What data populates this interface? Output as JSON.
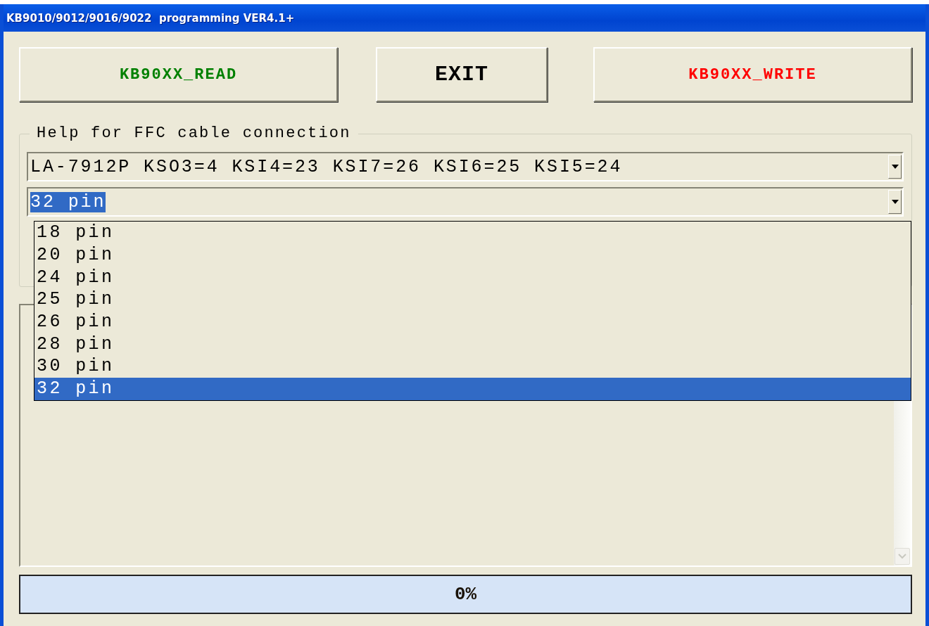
{
  "window": {
    "title": "KB9010/9012/9016/9022  programming VER4.1+"
  },
  "buttons": [
    {
      "label": "KB90XX_READ",
      "color": "#008000"
    },
    {
      "label": "EXIT",
      "color": "#000000"
    },
    {
      "label": "KB90XX_WRITE",
      "color": "#ff0000"
    }
  ],
  "help_group": {
    "legend": "Help for FFC cable connection",
    "cable_combo": {
      "value": "LA-7912P KSO3=4 KSI4=23 KSI7=26 KSI6=25 KSI5=24"
    },
    "pin_combo": {
      "value": "32 pin",
      "options": [
        {
          "label": "18 pin",
          "selected": false
        },
        {
          "label": "20 pin",
          "selected": false
        },
        {
          "label": "24 pin",
          "selected": false
        },
        {
          "label": "25 pin",
          "selected": false
        },
        {
          "label": "26 pin",
          "selected": false
        },
        {
          "label": "28 pin",
          "selected": false
        },
        {
          "label": "30 pin",
          "selected": false
        },
        {
          "label": "32 pin",
          "selected": true
        }
      ]
    }
  },
  "progress": {
    "level": 0,
    "text": "0%"
  }
}
